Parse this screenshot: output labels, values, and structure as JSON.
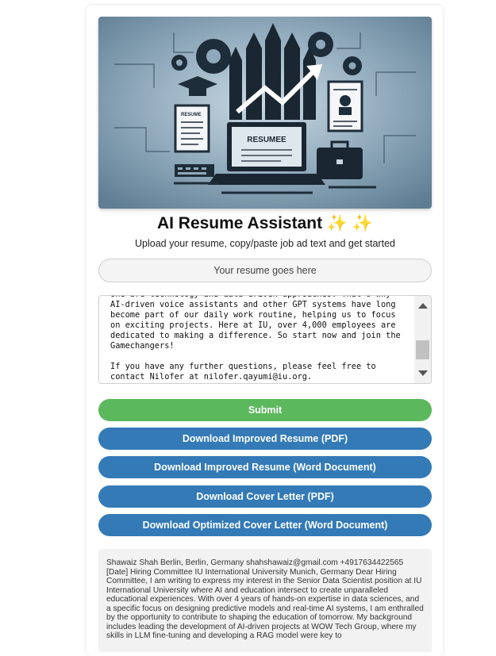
{
  "app": {
    "title": "AI Resume Assistant ✨ ✨",
    "subtitle": "Upload your resume, copy/paste job ad text and get started"
  },
  "hero": {
    "screen_label": "RESUMEE",
    "doc_label": "RESUME"
  },
  "upload": {
    "label": "Your resume goes here"
  },
  "job_ad": {
    "text": "one are technology and data-driven approaches. That's why AI-driven voice assistants and other GPT systems have long become part of our daily work routine, helping us to focus on exciting projects. Here at IU, over 4,000 employees are dedicated to making a difference. So start now and join the Gamechangers!\n\nIf you have any further questions, please feel free to contact Nilofer at nilofer.qayumi@iu.org."
  },
  "buttons": {
    "submit": "Submit",
    "download_resume_pdf": "Download Improved Resume (PDF)",
    "download_resume_word": "Download Improved Resume (Word Document)",
    "download_cover_pdf": "Download Cover Letter (PDF)",
    "download_cover_word": "Download Optimized Cover Letter (Word Document)"
  },
  "output": {
    "text": "Shawaiz Shah Berlin, Berlin, Germany shahshawaiz@gmail.com +4917634422565 [Date] Hiring Committee IU International University Munich, Germany Dear Hiring Committee, I am writing to express my interest in the Senior Data Scientist position at IU International University where AI and education intersect to create unparalleled educational experiences. With over 4 years of hands-on expertise in data sciences, and a specific focus on designing predictive models and real-time AI systems, I am enthralled by the opportunity to contribute to shaping the education of tomorrow. My background includes leading the development of AI-driven projects at WOW Tech Group, where my skills in LLM fine-tuning and developing a RAG model were key to"
  },
  "colors": {
    "submit": "#5cb85c",
    "primary": "#337ab7",
    "hero_bg": "#7e9bb0"
  }
}
